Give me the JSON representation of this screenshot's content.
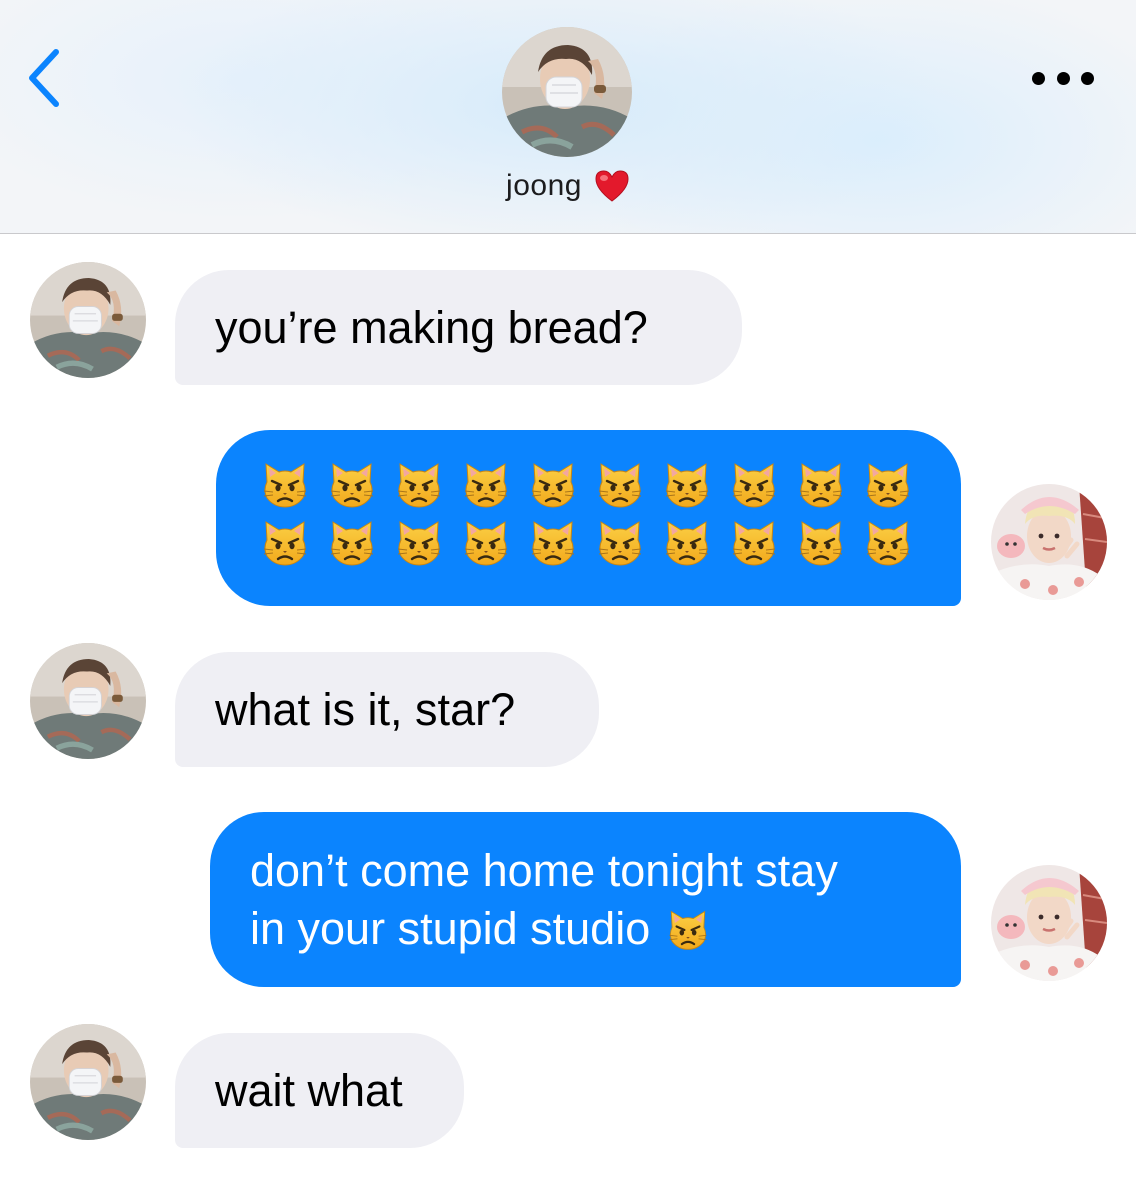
{
  "header": {
    "back_label": "Back",
    "contact_name": "joong",
    "contact_emoji_icon": "red-heart-icon",
    "more_icon": "more-options-icon"
  },
  "colors": {
    "outgoing_bubble": "#0b84fe",
    "incoming_bubble": "#efeff4",
    "accent": "#0b84fe",
    "heart": "#e3192c"
  },
  "messages": [
    {
      "direction": "incoming",
      "text": "you’re making bread?"
    },
    {
      "direction": "outgoing",
      "emoji": "pouting-cat-icon",
      "emoji_count": 20
    },
    {
      "direction": "incoming",
      "text": "what is it, star?"
    },
    {
      "direction": "outgoing",
      "line1": "don’t come home tonight stay",
      "line2": "in your stupid studio",
      "emoji": "pouting-cat-icon"
    },
    {
      "direction": "incoming",
      "text": "wait what"
    }
  ]
}
